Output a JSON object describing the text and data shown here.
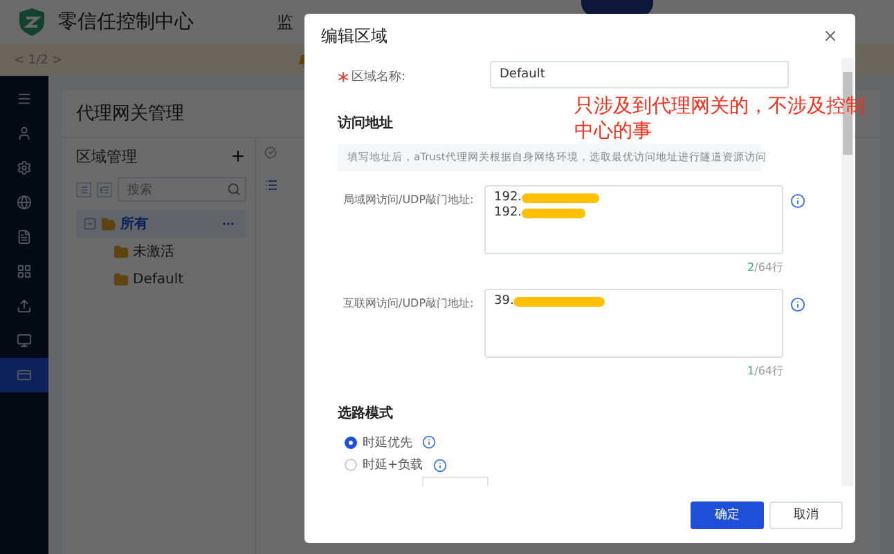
{
  "app": {
    "title": "零信任控制中心",
    "nav_label": "监"
  },
  "notice": {
    "pager": "< 1/2 >"
  },
  "sidebar": {
    "items": [
      {
        "selected": false
      },
      {
        "selected": false
      },
      {
        "selected": false
      },
      {
        "selected": false
      },
      {
        "selected": false
      },
      {
        "selected": false
      },
      {
        "selected": false
      },
      {
        "selected": true
      }
    ]
  },
  "page": {
    "title": "代理网关管理"
  },
  "area_panel": {
    "title": "区域管理",
    "search": {
      "placeholder": "搜索"
    },
    "tree": [
      {
        "label": "所有",
        "selected": true,
        "expanded": true,
        "children": [
          {
            "label": "未激活",
            "selected": false
          },
          {
            "label": "Default",
            "selected": false
          }
        ]
      }
    ]
  },
  "dialog": {
    "title": "编辑区域",
    "name_field": {
      "label": "区域名称:",
      "required_mark": "*",
      "value": "Default"
    },
    "access": {
      "title": "访问地址",
      "tip": "填写地址后，aTrust代理网关根据自身网络环境，选取最优访问地址进行隧道资源访问",
      "fields": [
        {
          "label": "局域网访问/UDP敲门地址:",
          "lines": [
            "192.",
            "192."
          ],
          "count": "2",
          "limit": "/64行"
        },
        {
          "label": "互联网访问/UDP敲门地址:",
          "lines": [
            "39."
          ],
          "count": "1",
          "limit": "/64行"
        }
      ]
    },
    "routing": {
      "title": "选路模式",
      "options": [
        {
          "label": "时延优先",
          "selected": true
        },
        {
          "label": "时延+负载",
          "selected": false
        }
      ]
    },
    "buttons": [
      {
        "label": "确定",
        "kind": "primary"
      },
      {
        "label": "取消",
        "kind": "default"
      }
    ]
  },
  "annotation": {
    "text": "只涉及到代理网关的，不涉及控制中心的事"
  }
}
